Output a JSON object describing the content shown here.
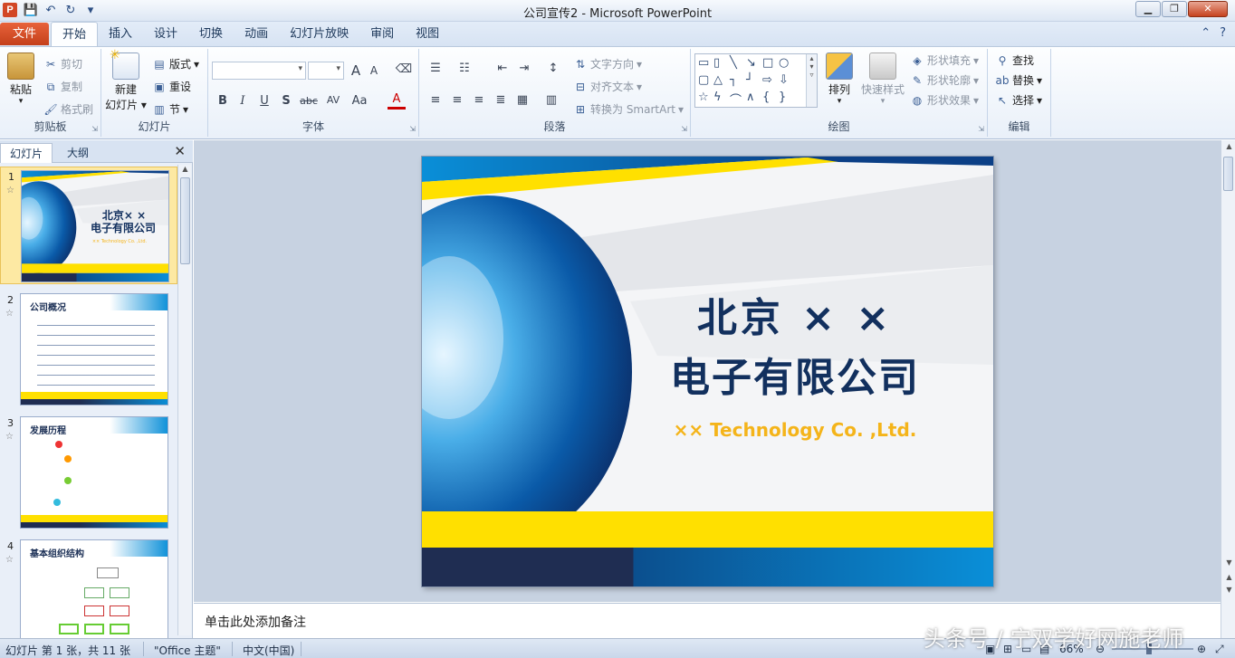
{
  "window": {
    "title": "公司宣传2  -  Microsoft PowerPoint"
  },
  "qat": {
    "save": "💾",
    "undo": "↶",
    "redo": "↻",
    "more": "▾"
  },
  "file_tab": "文件",
  "tabs": [
    "开始",
    "插入",
    "设计",
    "切换",
    "动画",
    "幻灯片放映",
    "审阅",
    "视图"
  ],
  "ribbon": {
    "clipboard": {
      "paste": "粘贴",
      "cut": "剪切",
      "copy": "复制",
      "format_painter": "格式刷",
      "label": "剪贴板"
    },
    "slides": {
      "new_slide_line1": "新建",
      "new_slide_line2": "幻灯片",
      "layout": "版式",
      "reset": "重设",
      "section": "节",
      "label": "幻灯片"
    },
    "font": {
      "label": "字体",
      "bold": "B",
      "italic": "I",
      "underline": "U",
      "shadow": "S",
      "strike": "abc",
      "spacing": "AV",
      "case": "Aa",
      "color": "A",
      "grow": "A",
      "shrink": "A"
    },
    "paragraph": {
      "text_direction": "文字方向",
      "align_text": "对齐文本",
      "smartart": "转换为 SmartArt",
      "label": "段落"
    },
    "drawing": {
      "arrange": "排列",
      "quick_styles": "快速样式",
      "shape_fill": "形状填充",
      "shape_outline": "形状轮廓",
      "shape_effects": "形状效果",
      "label": "绘图"
    },
    "editing": {
      "find": "查找",
      "replace": "替换",
      "select": "选择",
      "label": "编辑"
    }
  },
  "panel": {
    "tab_slides": "幻灯片",
    "tab_outline": "大纲",
    "thumbs": [
      {
        "num": "1",
        "title_line1": "北京× ×",
        "title_line2": "电子有限公司",
        "sub": "×× Technology  Co. ,Ltd."
      },
      {
        "num": "2",
        "title": "公司概况"
      },
      {
        "num": "3",
        "title": "发展历程"
      },
      {
        "num": "4",
        "title": "基本组织结构"
      }
    ]
  },
  "slide": {
    "title_line1": "北京 × ×",
    "title_line2": "电子有限公司",
    "subtitle": "×× Technology Co. ,Ltd."
  },
  "notes": {
    "placeholder": "单击此处添加备注"
  },
  "status": {
    "slide_info": "幻灯片 第 1 张，共 11 张",
    "theme": "\"Office 主题\"",
    "language": "中文(中国)",
    "zoom": "66%"
  },
  "watermark": "头条号 / 宁双学好网施老师",
  "colors": {
    "file_tab": "#d24726",
    "slide_title": "#12305e",
    "slide_subtitle": "#f4b41a",
    "accent_blue": "#0a8fd8",
    "accent_yellow": "#ffe000"
  }
}
